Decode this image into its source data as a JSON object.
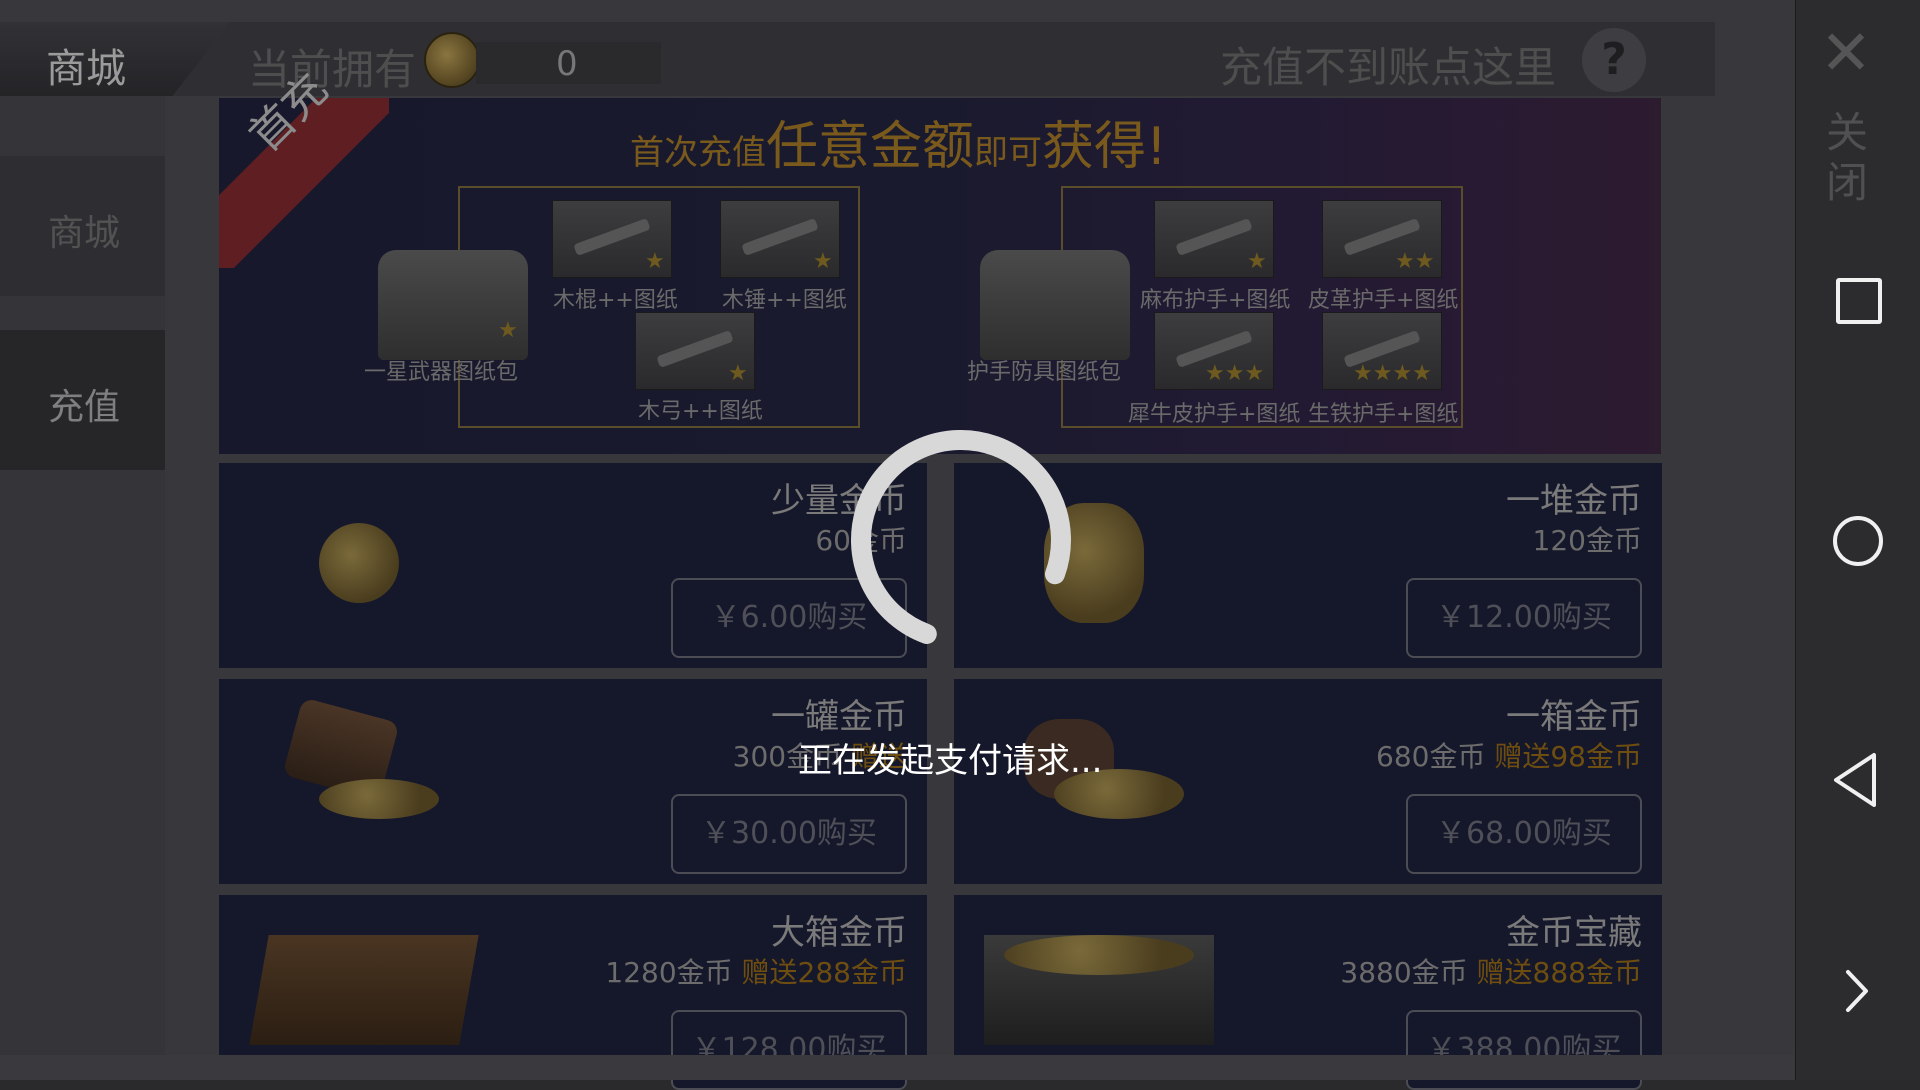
{
  "header": {
    "shop_tab": "商城",
    "owned_label": "当前拥有",
    "balance": "0",
    "help_text": "充值不到账点这里",
    "help_icon": "?"
  },
  "sidebar": {
    "items": [
      {
        "label": "商城"
      },
      {
        "label": "充值"
      }
    ]
  },
  "banner": {
    "ribbon": "首充",
    "headline_parts": [
      "首次充值",
      "任意金额",
      "即可",
      "获得",
      "!"
    ],
    "left_bundle": {
      "label": "一星武器图纸包",
      "items": [
        "木棍++图纸",
        "木锤++图纸",
        "木弓++图纸"
      ]
    },
    "right_bundle": {
      "label": "护手防具图纸包",
      "items": [
        "麻布护手+图纸",
        "皮革护手+图纸",
        "犀牛皮护手+图纸",
        "生铁护手+图纸"
      ]
    }
  },
  "products": [
    {
      "name": "少量金币",
      "amount": "60金币",
      "bonus": "",
      "price": "￥6.00购买"
    },
    {
      "name": "一堆金币",
      "amount": "120金币",
      "bonus": "",
      "price": "￥12.00购买"
    },
    {
      "name": "一罐金币",
      "amount": "300金币",
      "bonus": "赠送",
      "price": "￥30.00购买"
    },
    {
      "name": "一箱金币",
      "amount": "680金币",
      "bonus": "赠送98金币",
      "price": "￥68.00购买"
    },
    {
      "name": "大箱金币",
      "amount": "1280金币",
      "bonus": "赠送288金币",
      "price": "￥128.00购买"
    },
    {
      "name": "金币宝藏",
      "amount": "3880金币",
      "bonus": "赠送888金币",
      "price": "￥388.00购买"
    }
  ],
  "overlay": {
    "loading_text": "正在发起支付请求..."
  },
  "navbar": {
    "close_label": "关闭",
    "icons": [
      "close-icon",
      "square-icon",
      "circle-icon",
      "back-triangle-icon",
      "chevron-right-icon"
    ]
  },
  "colors": {
    "accent_gold": "#d9a23a",
    "ribbon_red": "#b8333a",
    "card_bg": "#15172a"
  }
}
